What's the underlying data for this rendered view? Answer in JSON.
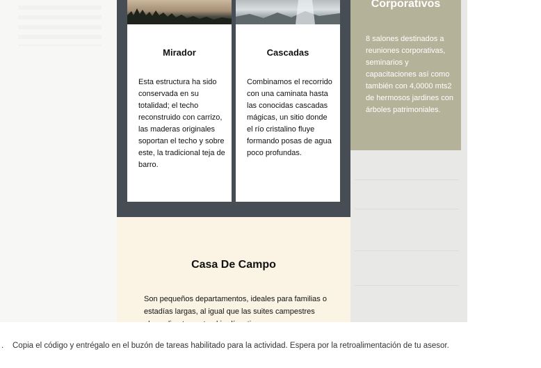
{
  "cards": [
    {
      "title": "Mirador",
      "text": "Esta estructura ha sido conservada en su totalidad; el techo reconstruido con carrizo, las maderas originales soportan el techo y sobre este, la tradicional teja de barro."
    },
    {
      "title": "Cascadas",
      "text": "Combinamos el recorrido con una caminata hasta las conocidas cascadas mágicas, un sitio donde el río cristalino fluye formando posas de agua poco profundas."
    }
  ],
  "side_panel": {
    "title": "Corporativos",
    "text": "8 salones destinados a reuniones corporativas, seminarios y capacitaciones así como también con 4,0000 mts2 de hermosos jardines con árboles patrimoniales."
  },
  "casa_de_campo": {
    "title": "Casa De Campo",
    "text": "Son pequeños departamentos, ideales para familias o estadías largas, al igual que las suites campestres abren directamente al jardín y tienen"
  },
  "instruction": {
    "bullet": ".",
    "text": "Copia el código y entrégalo en el buzón de tareas habilitado para la actividad. Espera por la retroalimentación de tu asesor."
  },
  "colors": {
    "dark_section": "#464d55",
    "side_panel_accent": "#b5b29a",
    "cream_section": "#fbf3e4"
  }
}
